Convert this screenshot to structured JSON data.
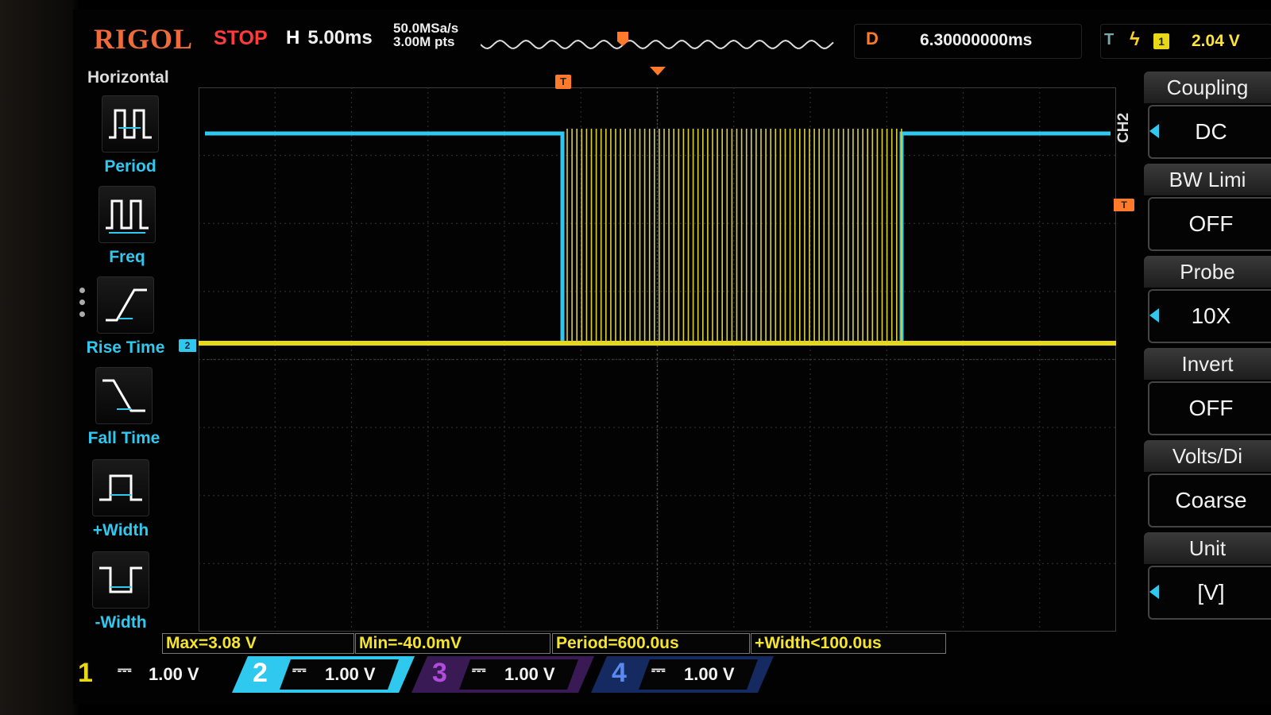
{
  "top_bar": {
    "brand": "RIGOL",
    "run_status": "STOP",
    "horizontal_label": "H",
    "timebase": "5.00ms",
    "sample_rate": "50.0MSa/s",
    "memory_depth": "3.00M pts",
    "delay_label": "D",
    "delay_value": "6.30000000ms",
    "trigger_label": "T",
    "trigger_edge": "ϟ",
    "trigger_source": "1",
    "trigger_level": "2.04 V"
  },
  "left_menu": {
    "title": "Horizontal",
    "items": [
      {
        "label": "Period",
        "icon": "period-icon"
      },
      {
        "label": "Freq",
        "icon": "freq-icon"
      },
      {
        "label": "Rise Time",
        "icon": "rise-time-icon"
      },
      {
        "label": "Fall Time",
        "icon": "fall-time-icon"
      },
      {
        "label": "+Width",
        "icon": "positive-width-icon"
      },
      {
        "label": "-Width",
        "icon": "negative-width-icon"
      }
    ]
  },
  "right_menu": {
    "channel": "CH2",
    "items": [
      {
        "title": "Coupling",
        "value": "DC",
        "arrow": true
      },
      {
        "title": "BW Limi",
        "value": "OFF",
        "arrow": false
      },
      {
        "title": "Probe",
        "value": "10X",
        "arrow": true
      },
      {
        "title": "Invert",
        "value": "OFF",
        "arrow": false
      },
      {
        "title": "Volts/Di",
        "value": "Coarse",
        "arrow": false
      },
      {
        "title": "Unit",
        "value": "[V]",
        "arrow": true
      }
    ]
  },
  "measurements": [
    "Max=3.08 V",
    "Min=-40.0mV",
    "Period=600.0us",
    "+Width<100.0us"
  ],
  "channels": [
    {
      "number": "1",
      "coupling": "⎓",
      "scale": "1.00 V",
      "color": "#e8d816"
    },
    {
      "number": "2",
      "coupling": "⎓",
      "scale": "1.00 V",
      "color": "#2fc8ef"
    },
    {
      "number": "3",
      "coupling": "⎓",
      "scale": "1.00 V",
      "color": "#b04cdc"
    },
    {
      "number": "4",
      "coupling": "⎓",
      "scale": "1.00 V",
      "color": "#3d6fe0"
    }
  ],
  "markers": {
    "ch2_ground": "2",
    "trigger_level_marker": "T"
  },
  "colors": {
    "ch1": "#e8d816",
    "ch2": "#2fc8ef",
    "brand": "#f06b3a",
    "stop": "#ff3b3b"
  }
}
